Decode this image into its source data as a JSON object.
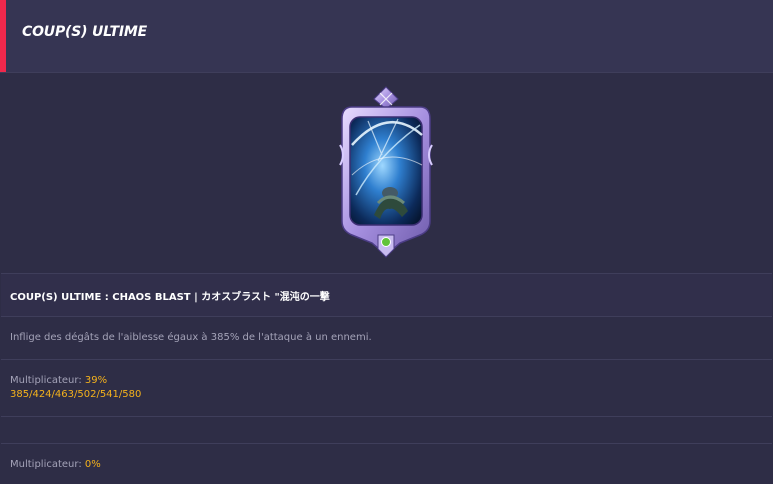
{
  "header": {
    "title": "COUP(S) ULTIME",
    "accent_color": "#f0284c"
  },
  "card": {
    "icon": "ultimate-skill-card-icon"
  },
  "skill": {
    "name": "COUP(S) ULTIME : CHAOS BLAST | カオスブラスト \"混沌の一撃"
  },
  "description": "Inflige des dégâts de l'aiblesse égaux à 385% de l'attaque à un ennemi.",
  "multiplier_1": {
    "label": "Multiplicateur: ",
    "value": "39%",
    "sequence": "385/424/463/502/541/580"
  },
  "multiplier_2": {
    "label": "Multiplicateur: ",
    "value": "0%"
  },
  "colors": {
    "background": "#2e2d46",
    "header_bg": "#363553",
    "highlight": "#f5b21c"
  }
}
